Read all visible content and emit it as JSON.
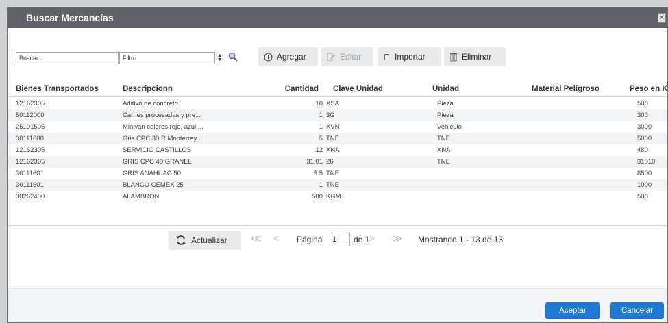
{
  "dialog": {
    "title": "Buscar Mercancías",
    "close_glyph": "✕"
  },
  "toolbar": {
    "search_placeholder": "Buscar...",
    "filter_value": "Filtro",
    "add_label": "Agregar",
    "edit_label": "Editar",
    "import_label": "Importar",
    "delete_label": "Eliminar"
  },
  "table": {
    "headers": [
      "Bienes Transportados",
      "Descripcionn",
      "Cantidad",
      "Clave Unidad",
      "Unidad",
      "Material Peligroso",
      "Peso en K"
    ],
    "rows": [
      [
        "12162305",
        "Aditivo de concreto",
        "10",
        "XSA",
        "Pieza",
        "",
        "500"
      ],
      [
        "50112000",
        "Carnes procesadas y pre...",
        "1",
        "3G",
        "Pieza",
        "",
        "300"
      ],
      [
        "25101505",
        "Minivan colores rojo, azul ...",
        "1",
        "XVN",
        "Vehiculo",
        "",
        "3000"
      ],
      [
        "30111600",
        "Gris CPC 30 R Monterrey ...",
        "5",
        "TNE",
        "TNE",
        "",
        "5000"
      ],
      [
        "12162305",
        "SERVICIO CASTILLOS",
        "12",
        "XNA",
        "XNA",
        "",
        "480"
      ],
      [
        "12162305",
        "GRIS CPC 40 GRANEL",
        "31.01",
        "26",
        "TNE",
        "",
        "31010"
      ],
      [
        "30111601",
        "GRIS ANAHUAC 50",
        "8.5",
        "TNE",
        "",
        "",
        "8500"
      ],
      [
        "30111601",
        "BLANCO CEMEX 25",
        "1",
        "TNE",
        "",
        "",
        "1000"
      ],
      [
        "30262400",
        "ALAMBRON",
        "500",
        "KGM",
        "",
        "",
        "500"
      ]
    ]
  },
  "pager": {
    "refresh_label": "Actualizar",
    "first_glyph": "≪",
    "prev_glyph": "<",
    "page_label": "Página",
    "page_value": "1",
    "of_label": "de 1",
    "next_glyph": ">",
    "last_glyph": "≫",
    "showing": "Mostrando 1 - 13 de 13"
  },
  "footer": {
    "accept_label": "Aceptar",
    "cancel_label": "Cancelar"
  },
  "colors": {
    "titlebar": "#5f6266",
    "primary_button": "#1f78d1"
  }
}
